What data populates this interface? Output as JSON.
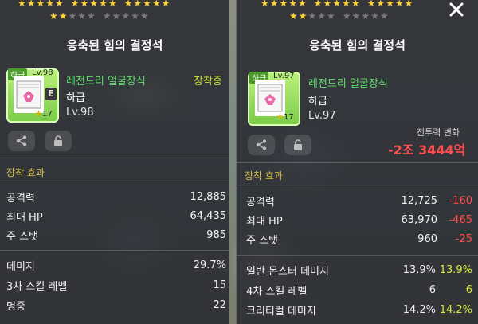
{
  "left": {
    "title": "응축된 힘의 결정석",
    "item_name": "레전드리 얼굴장식",
    "grade": "하급",
    "level": "Lv.98",
    "equipped": "장착중",
    "icon_grade": "하급",
    "icon_level": "Lv.98",
    "icon_badge": "E",
    "icon_stars": "17",
    "section": "장착 효과",
    "stats_a": [
      {
        "name": "공격력",
        "value": "12,885"
      },
      {
        "name": "최대 HP",
        "value": "64,435"
      },
      {
        "name": "주 스탯",
        "value": "985"
      }
    ],
    "stats_b": [
      {
        "name": "데미지",
        "value": "29.7%"
      },
      {
        "name": "3차 스킬 레벨",
        "value": "15"
      },
      {
        "name": "명중",
        "value": "22"
      }
    ]
  },
  "right": {
    "title": "응축된 힘의 결정석",
    "item_name": "레전드리 얼굴장식",
    "grade": "하급",
    "level": "Lv.97",
    "icon_grade": "하급",
    "icon_level": "Lv.97",
    "icon_stars": "17",
    "combat_label": "전투력 변화",
    "combat_value": "-2조 3444억",
    "section": "장착 효과",
    "stats_a": [
      {
        "name": "공격력",
        "value": "12,725",
        "delta": "-160"
      },
      {
        "name": "최대 HP",
        "value": "63,970",
        "delta": "-465"
      },
      {
        "name": "주 스탯",
        "value": "960",
        "delta": "-25"
      }
    ],
    "stats_b": [
      {
        "name": "일반 몬스터 데미지",
        "value": "13.9%",
        "delta": "13.9%"
      },
      {
        "name": "4차 스킬 레벨",
        "value": "6",
        "delta": "6"
      },
      {
        "name": "크리티컬 데미지",
        "value": "14.2%",
        "delta": "14.2%"
      }
    ]
  },
  "icons": {
    "share": "share-icon",
    "lock": "lock-icon",
    "close": "close-icon"
  },
  "colors": {
    "item_name": "#5fdc6a",
    "equipped": "#c9e23a",
    "section": "#d8c24a",
    "negative": "#ff4d4d",
    "positive": "#d7e93a",
    "icon_bg": "#8fdc55"
  }
}
